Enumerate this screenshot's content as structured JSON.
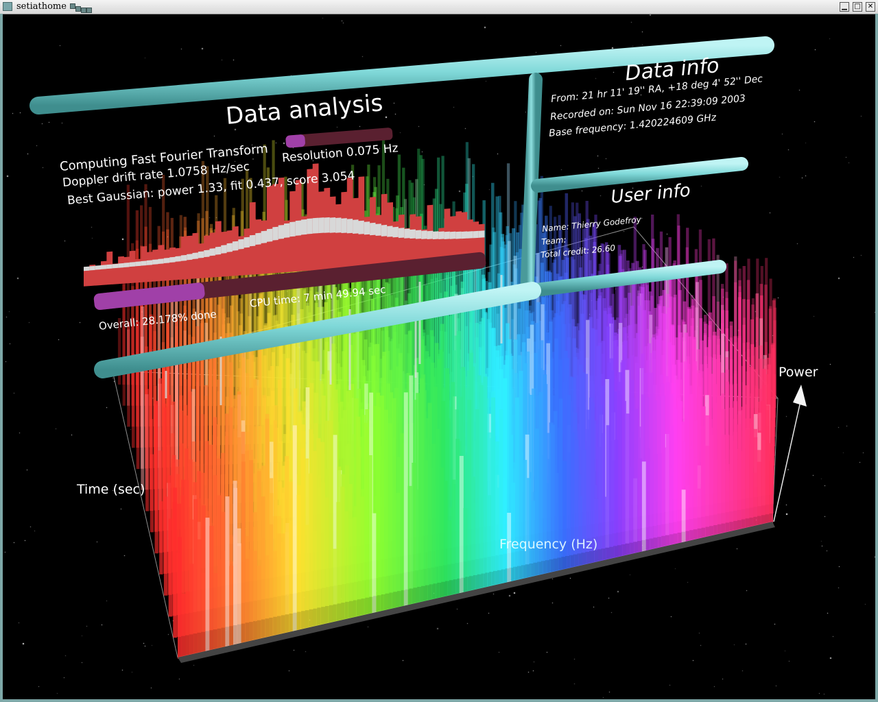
{
  "window": {
    "title": "setiathome",
    "minimize_label": "▁",
    "maximize_label": "□",
    "close_label": "✕"
  },
  "data_analysis": {
    "heading": "Data analysis",
    "status_line": "Computing Fast Fourier Transform",
    "resolution": "Resolution 0.075 Hz",
    "doppler": "Doppler drift rate 1.0758 Hz/sec",
    "gaussian": "Best Gaussian: power 1.33, fit 0.437, score 3.054",
    "overall": "Overall: 28.178% done",
    "cpu_time": "CPU time: 7 min 49.94 sec",
    "fft_progress": 0.18,
    "overall_progress": 0.28178
  },
  "data_info": {
    "heading": "Data info",
    "from": "From: 21 hr 11' 19'' RA, +18 deg 4' 52'' Dec",
    "recorded": "Recorded on: Sun Nov 16 22:39:09 2003",
    "base_frequency": "Base frequency: 1.420224609 GHz"
  },
  "user_info": {
    "heading": "User info",
    "name": "Name: Thierry Godefroy",
    "team": "Team:",
    "total_credit": "Total credit: 26.60"
  },
  "graph": {
    "axis_time": "Time (sec)",
    "axis_frequency": "Frequency (Hz)",
    "axis_power": "Power"
  },
  "colors": {
    "pipe": "#7fd8d8",
    "progress_fill": "#a040a8",
    "progress_track": "#5a2030",
    "gaussian_red": "#d04040",
    "gaussian_grey": "#d8d8d8",
    "background": "#000000"
  }
}
